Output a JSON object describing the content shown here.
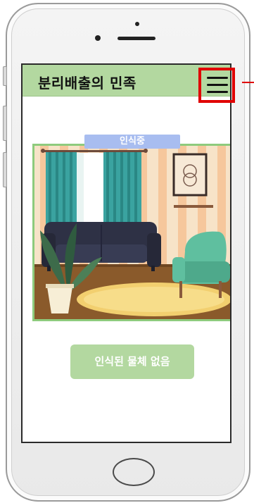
{
  "header": {
    "title": "분리배출의 민족"
  },
  "menu": {
    "icon": "hamburger-menu-icon"
  },
  "camera": {
    "status_badge": "인식중",
    "scene_description_icon": "living-room-illustration"
  },
  "result": {
    "label": "인식된 물체 없음"
  },
  "colors": {
    "header_bg": "#b3d8a0",
    "badge_bg": "#a8bdf0",
    "frame_border": "#8ecb7d",
    "highlight": "#e00000"
  }
}
